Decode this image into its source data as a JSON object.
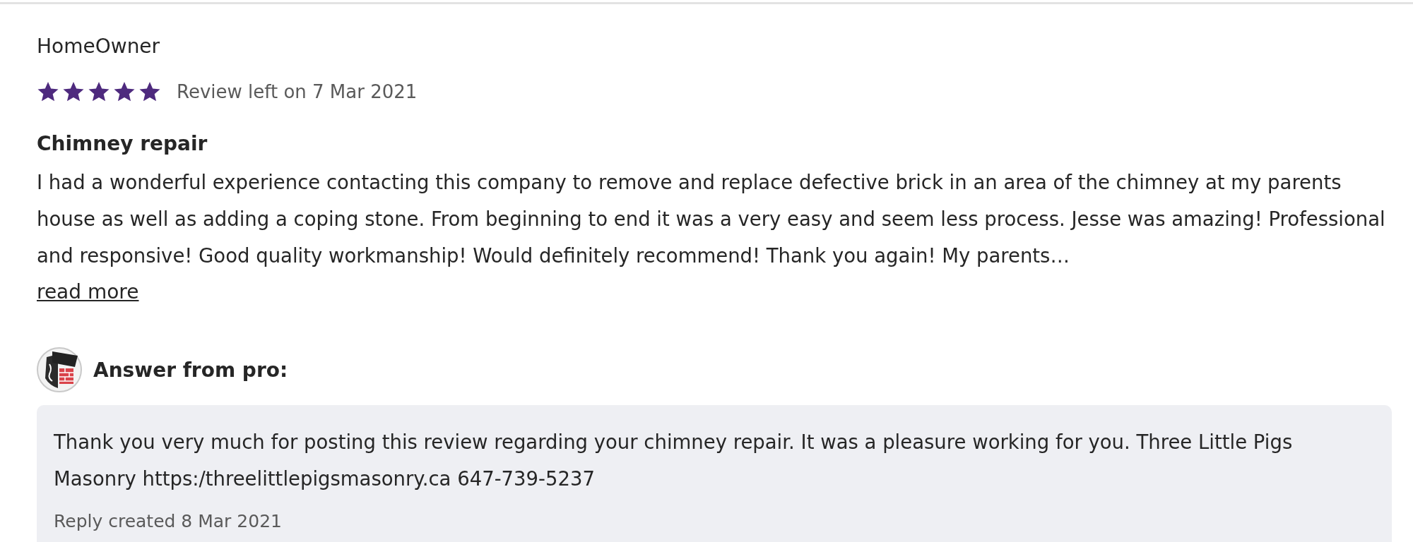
{
  "review": {
    "author": "HomeOwner",
    "stars": 5,
    "date_text": "Review left on 7 Mar 2021",
    "title": "Chimney repair",
    "body": "I had a wonderful experience contacting this company to remove and replace defective brick in an area of the chimney at my parents house as well as adding a coping stone. From beginning to end it was a very easy and seem less process. Jesse was amazing! Professional and responsive! Good quality workmanship! Would definitely recommend! Thank you again! My parents…",
    "read_more": "read more"
  },
  "answer": {
    "heading": "Answer from pro:",
    "text": "Thank you very much for posting this review regarding your chimney repair. It was a pleasure working for you. Three Little Pigs Masonry https:/threelittlepigsmasonry.ca 647-739-5237",
    "created": "Reply created 8 Mar 2021"
  }
}
